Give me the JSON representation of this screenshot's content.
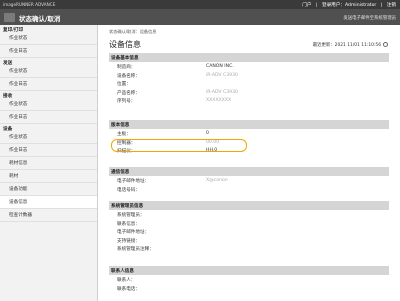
{
  "topbar": {
    "product": "imageRUNNER ADVANCE",
    "portal": "门户",
    "login_user_label": "登录用户：",
    "user": "Administrator",
    "logout": "注销"
  },
  "titlebar": {
    "title": "状态确认/取消",
    "mail_link": "发送电子邮件至系统管理员"
  },
  "sidebar": {
    "groups": [
      {
        "label": "复印/打印",
        "items": [
          "作业状态",
          "作业日志"
        ]
      },
      {
        "label": "发送",
        "items": [
          "作业状态",
          "作业日志"
        ]
      },
      {
        "label": "接收",
        "items": [
          "作业状态",
          "作业日志"
        ]
      },
      {
        "label": "设备",
        "items": [
          "作业状态",
          "作业日志",
          "耗材信息",
          "耗材",
          "设备功能",
          "设备信息",
          "检查计数器"
        ]
      }
    ]
  },
  "main": {
    "breadcrumb": "状态确认/取消：设备信息",
    "title": "设备信息",
    "updated_label": "最近更新：",
    "updated_value": "2021 11/01 11:10:56",
    "sections": [
      {
        "head": "设备基本信息",
        "rows": [
          {
            "label": "制造商：",
            "value": "CANON INC."
          },
          {
            "label": "设备名称：",
            "value": "iR-ADV C3930"
          },
          {
            "label": "位置：",
            "value": ""
          },
          {
            "label": "产品名称：",
            "value": "iR-ADV C3930"
          },
          {
            "label": "序列号：",
            "value": "XXXXXXXX"
          }
        ]
      },
      {
        "head": "版本信息",
        "rows": [
          {
            "label": "主板：",
            "value": "0"
          },
          {
            "label": "控制器：",
            "value": "00.00"
          },
          {
            "label": "扫描仪：",
            "value": "HH.0"
          }
        ]
      },
      {
        "head": "通信信息",
        "rows": [
          {
            "label": "电子邮件地址：",
            "value": "X@canon"
          },
          {
            "label": "电话号码：",
            "value": ""
          }
        ]
      },
      {
        "head": "系统管理员信息",
        "rows": [
          {
            "label": "系统管理员：",
            "value": ""
          },
          {
            "label": "联系信息：",
            "value": ""
          },
          {
            "label": "电子邮件地址：",
            "value": ""
          },
          {
            "label": "支持链接：",
            "value": ""
          },
          {
            "label": "系统管理员注释：",
            "value": ""
          }
        ]
      },
      {
        "head": "联系人信息",
        "rows": [
          {
            "label": "联系人：",
            "value": ""
          },
          {
            "label": "联系电话：",
            "value": ""
          }
        ]
      }
    ]
  },
  "colors": {
    "highlight": "#f0a800",
    "topbar": "#3a3a3a",
    "titlebar": "#505050"
  },
  "icons": {
    "logo": "brand-logo-icon",
    "refresh": "refresh-icon"
  }
}
